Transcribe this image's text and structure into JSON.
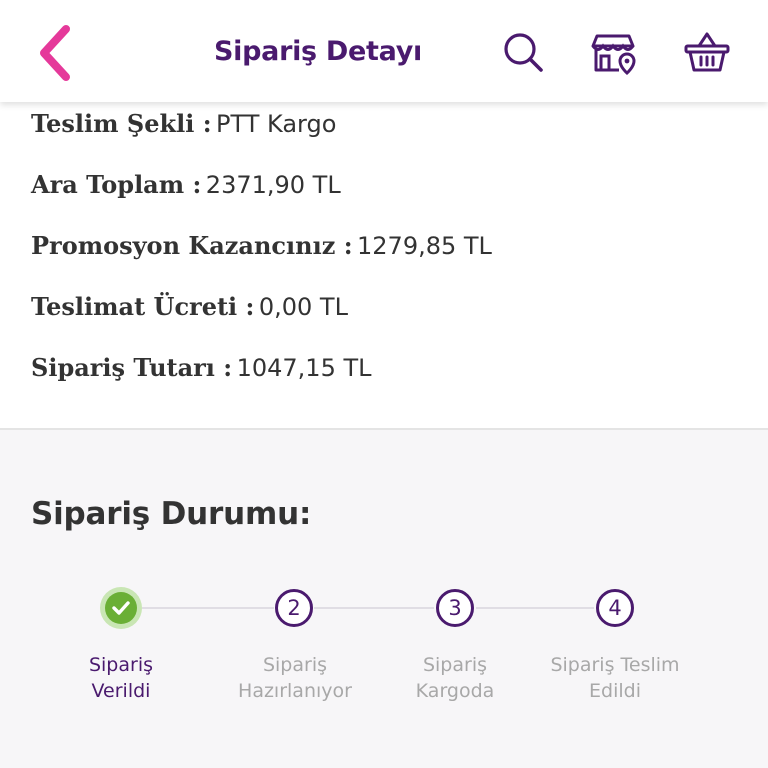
{
  "header": {
    "title": "Sipariş Detayı",
    "icons": [
      "back-chevron-icon",
      "search-icon",
      "store-location-icon",
      "basket-icon"
    ]
  },
  "colors": {
    "accent": "#e5399a",
    "brand": "#4a1a6e",
    "success": "#6aaf35",
    "muted": "#a8a8a8"
  },
  "details": [
    {
      "label": "Teslim Şekli :",
      "value": "PTT Kargo"
    },
    {
      "label": "Ara Toplam :",
      "value": "2371,90 TL"
    },
    {
      "label": "Promosyon Kazancınız :",
      "value": "1279,85 TL"
    },
    {
      "label": "Teslimat Ücreti :",
      "value": "0,00 TL"
    },
    {
      "label": "Sipariş Tutarı :",
      "value": "1047,15 TL"
    }
  ],
  "status": {
    "title": "Sipariş Durumu:",
    "steps": [
      {
        "number": "1",
        "label": "Sipariş\nVerildi",
        "done": true
      },
      {
        "number": "2",
        "label": "Sipariş\nHazırlanıyor",
        "done": false
      },
      {
        "number": "3",
        "label": "Sipariş\nKargoda",
        "done": false
      },
      {
        "number": "4",
        "label": "Sipariş Teslim\nEdildi",
        "done": false
      }
    ]
  }
}
